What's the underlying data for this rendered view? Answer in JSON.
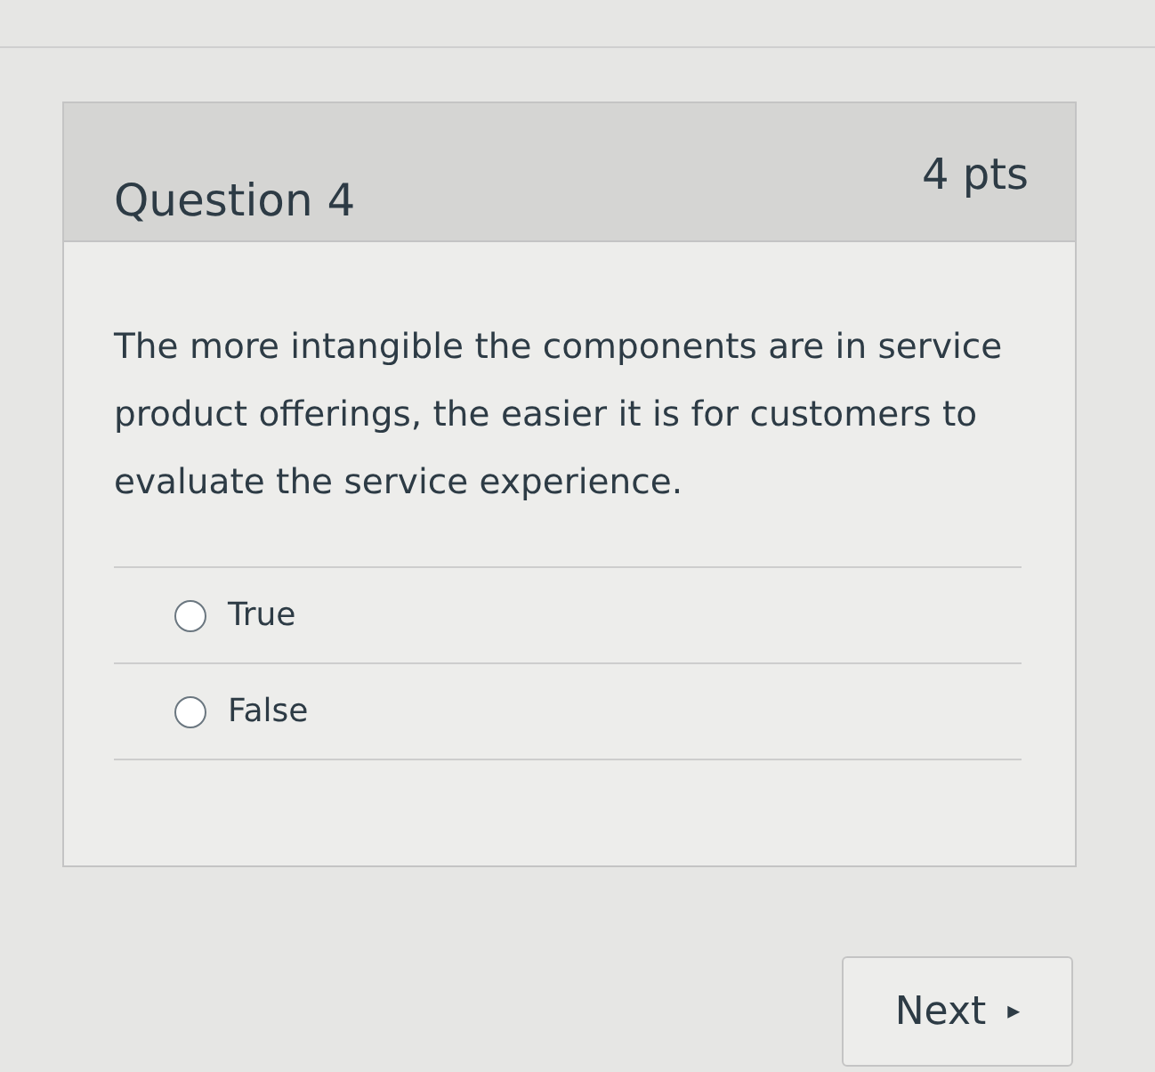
{
  "question": {
    "title": "Question 4",
    "points": "4 pts",
    "text": "The more intangible the components are in service product offerings, the easier it is for customers to evaluate the service experience.",
    "answers": [
      {
        "label": "True",
        "selected": false
      },
      {
        "label": "False",
        "selected": false
      }
    ]
  },
  "next_button": {
    "label": "Next",
    "icon": "▸"
  }
}
